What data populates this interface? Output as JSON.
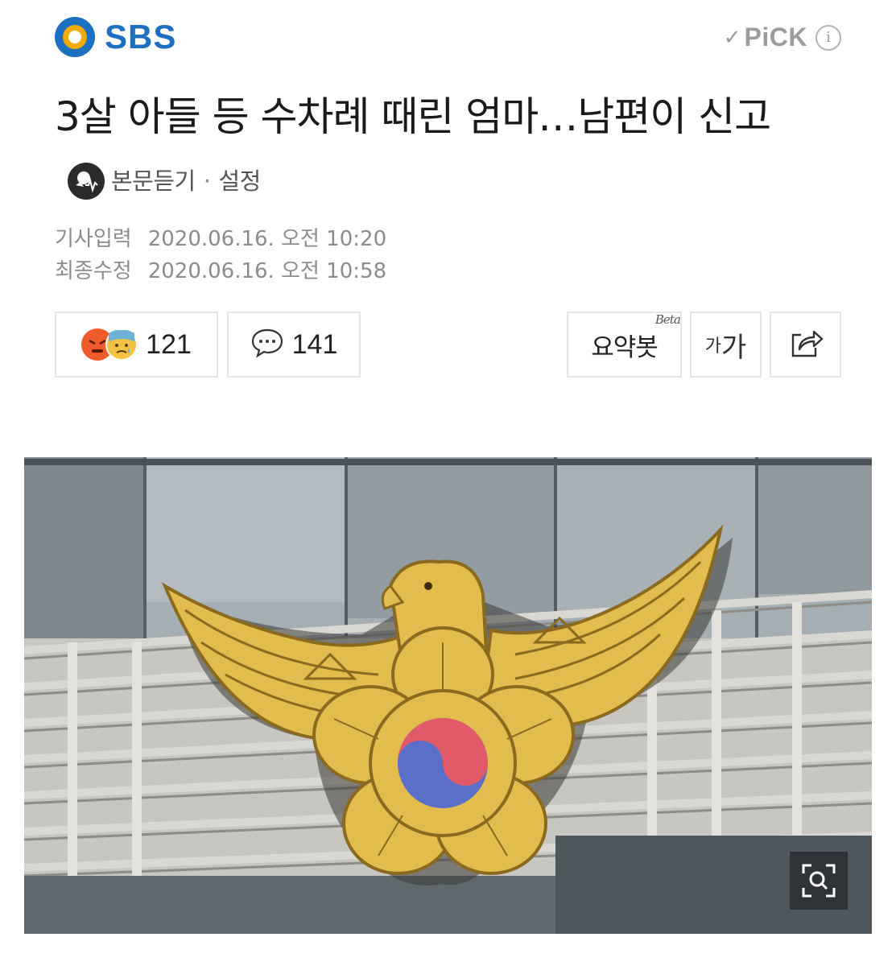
{
  "header": {
    "brand_text": "SBS",
    "brand_logo_icon": "sbs-logo-icon",
    "pick_label": "PiCK",
    "pick_check_icon": "check-icon",
    "pick_info_icon": "info-icon",
    "pick_info_glyph": "i"
  },
  "article": {
    "headline": "3살 아들 등 수차례 때린 엄마…남편이 신고",
    "listen_label": "본문듣기",
    "separator": "·",
    "settings_label": "설정",
    "published_key": "기사입력",
    "published_value": "2020.06.16. 오전 10:20",
    "modified_key": "최종수정",
    "modified_value": "2020.06.16. 오전 10:58"
  },
  "actions": {
    "reaction_count": "121",
    "comment_count": "141",
    "summary_label": "요약봇",
    "summary_badge": "Beta",
    "font_small": "가",
    "font_large": "가",
    "share_icon": "share-icon",
    "comment_icon": "speech-bubble-icon",
    "reaction_icons": [
      "angry-face-icon",
      "sad-face-icon"
    ]
  },
  "photo": {
    "subject": "police-emblem-photo",
    "zoom_icon": "zoom-icon"
  },
  "colors": {
    "brand_blue": "#1d6fc2",
    "brand_yellow": "#f2a900",
    "emblem_gold": "#e3bc4e",
    "taeguk_red": "#e05a6a",
    "taeguk_blue": "#5b6fc8"
  }
}
